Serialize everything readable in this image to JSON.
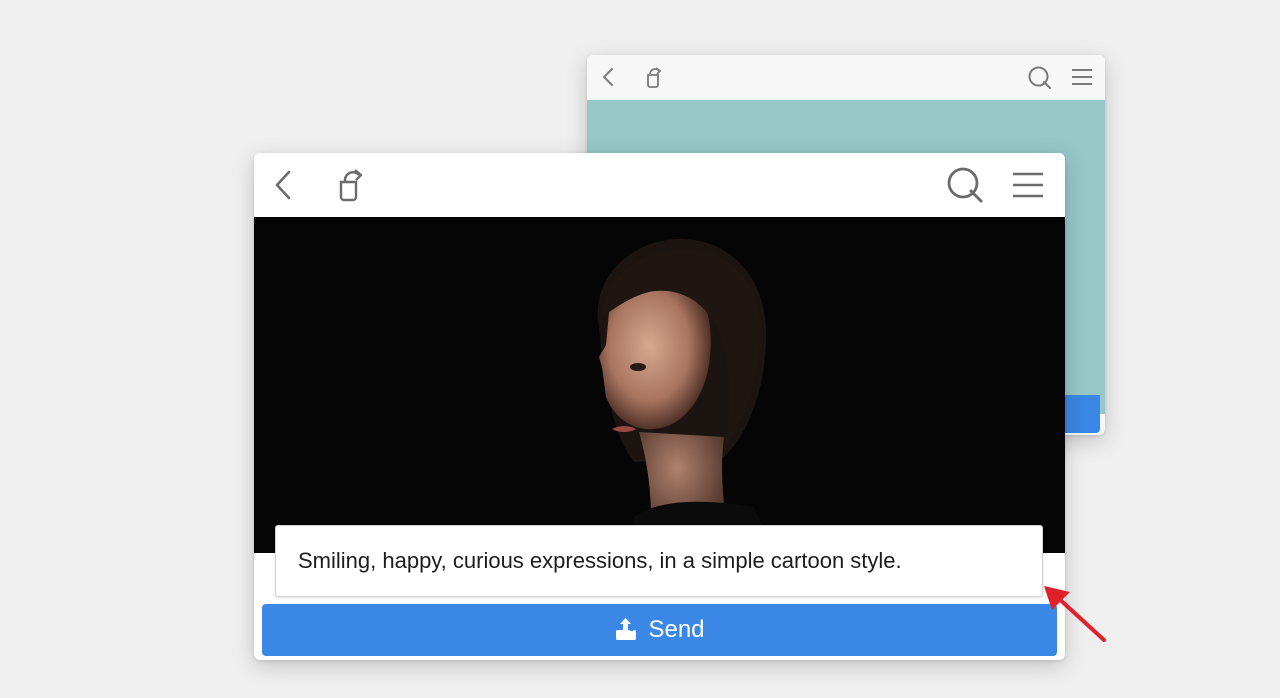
{
  "colors": {
    "page_bg": "#efefef",
    "accent": "#3a87e6",
    "teal_panel": "#97c7c7",
    "arrow": "#e0202a",
    "icon_gray": "#6b6b6b"
  },
  "back_window": {
    "toolbar": {
      "icons": [
        "back-chevron-icon",
        "share-icon",
        "search-icon",
        "menu-icon"
      ]
    }
  },
  "front_window": {
    "toolbar": {
      "icons": [
        "back-chevron-icon",
        "share-icon",
        "search-icon",
        "menu-icon"
      ]
    },
    "prompt": {
      "value": "Smiling, happy, curious expressions, in a simple cartoon style."
    },
    "send_button": {
      "label": "Send",
      "icon": "upload-icon"
    }
  },
  "annotation": {
    "icon": "pointer-arrow-icon"
  }
}
